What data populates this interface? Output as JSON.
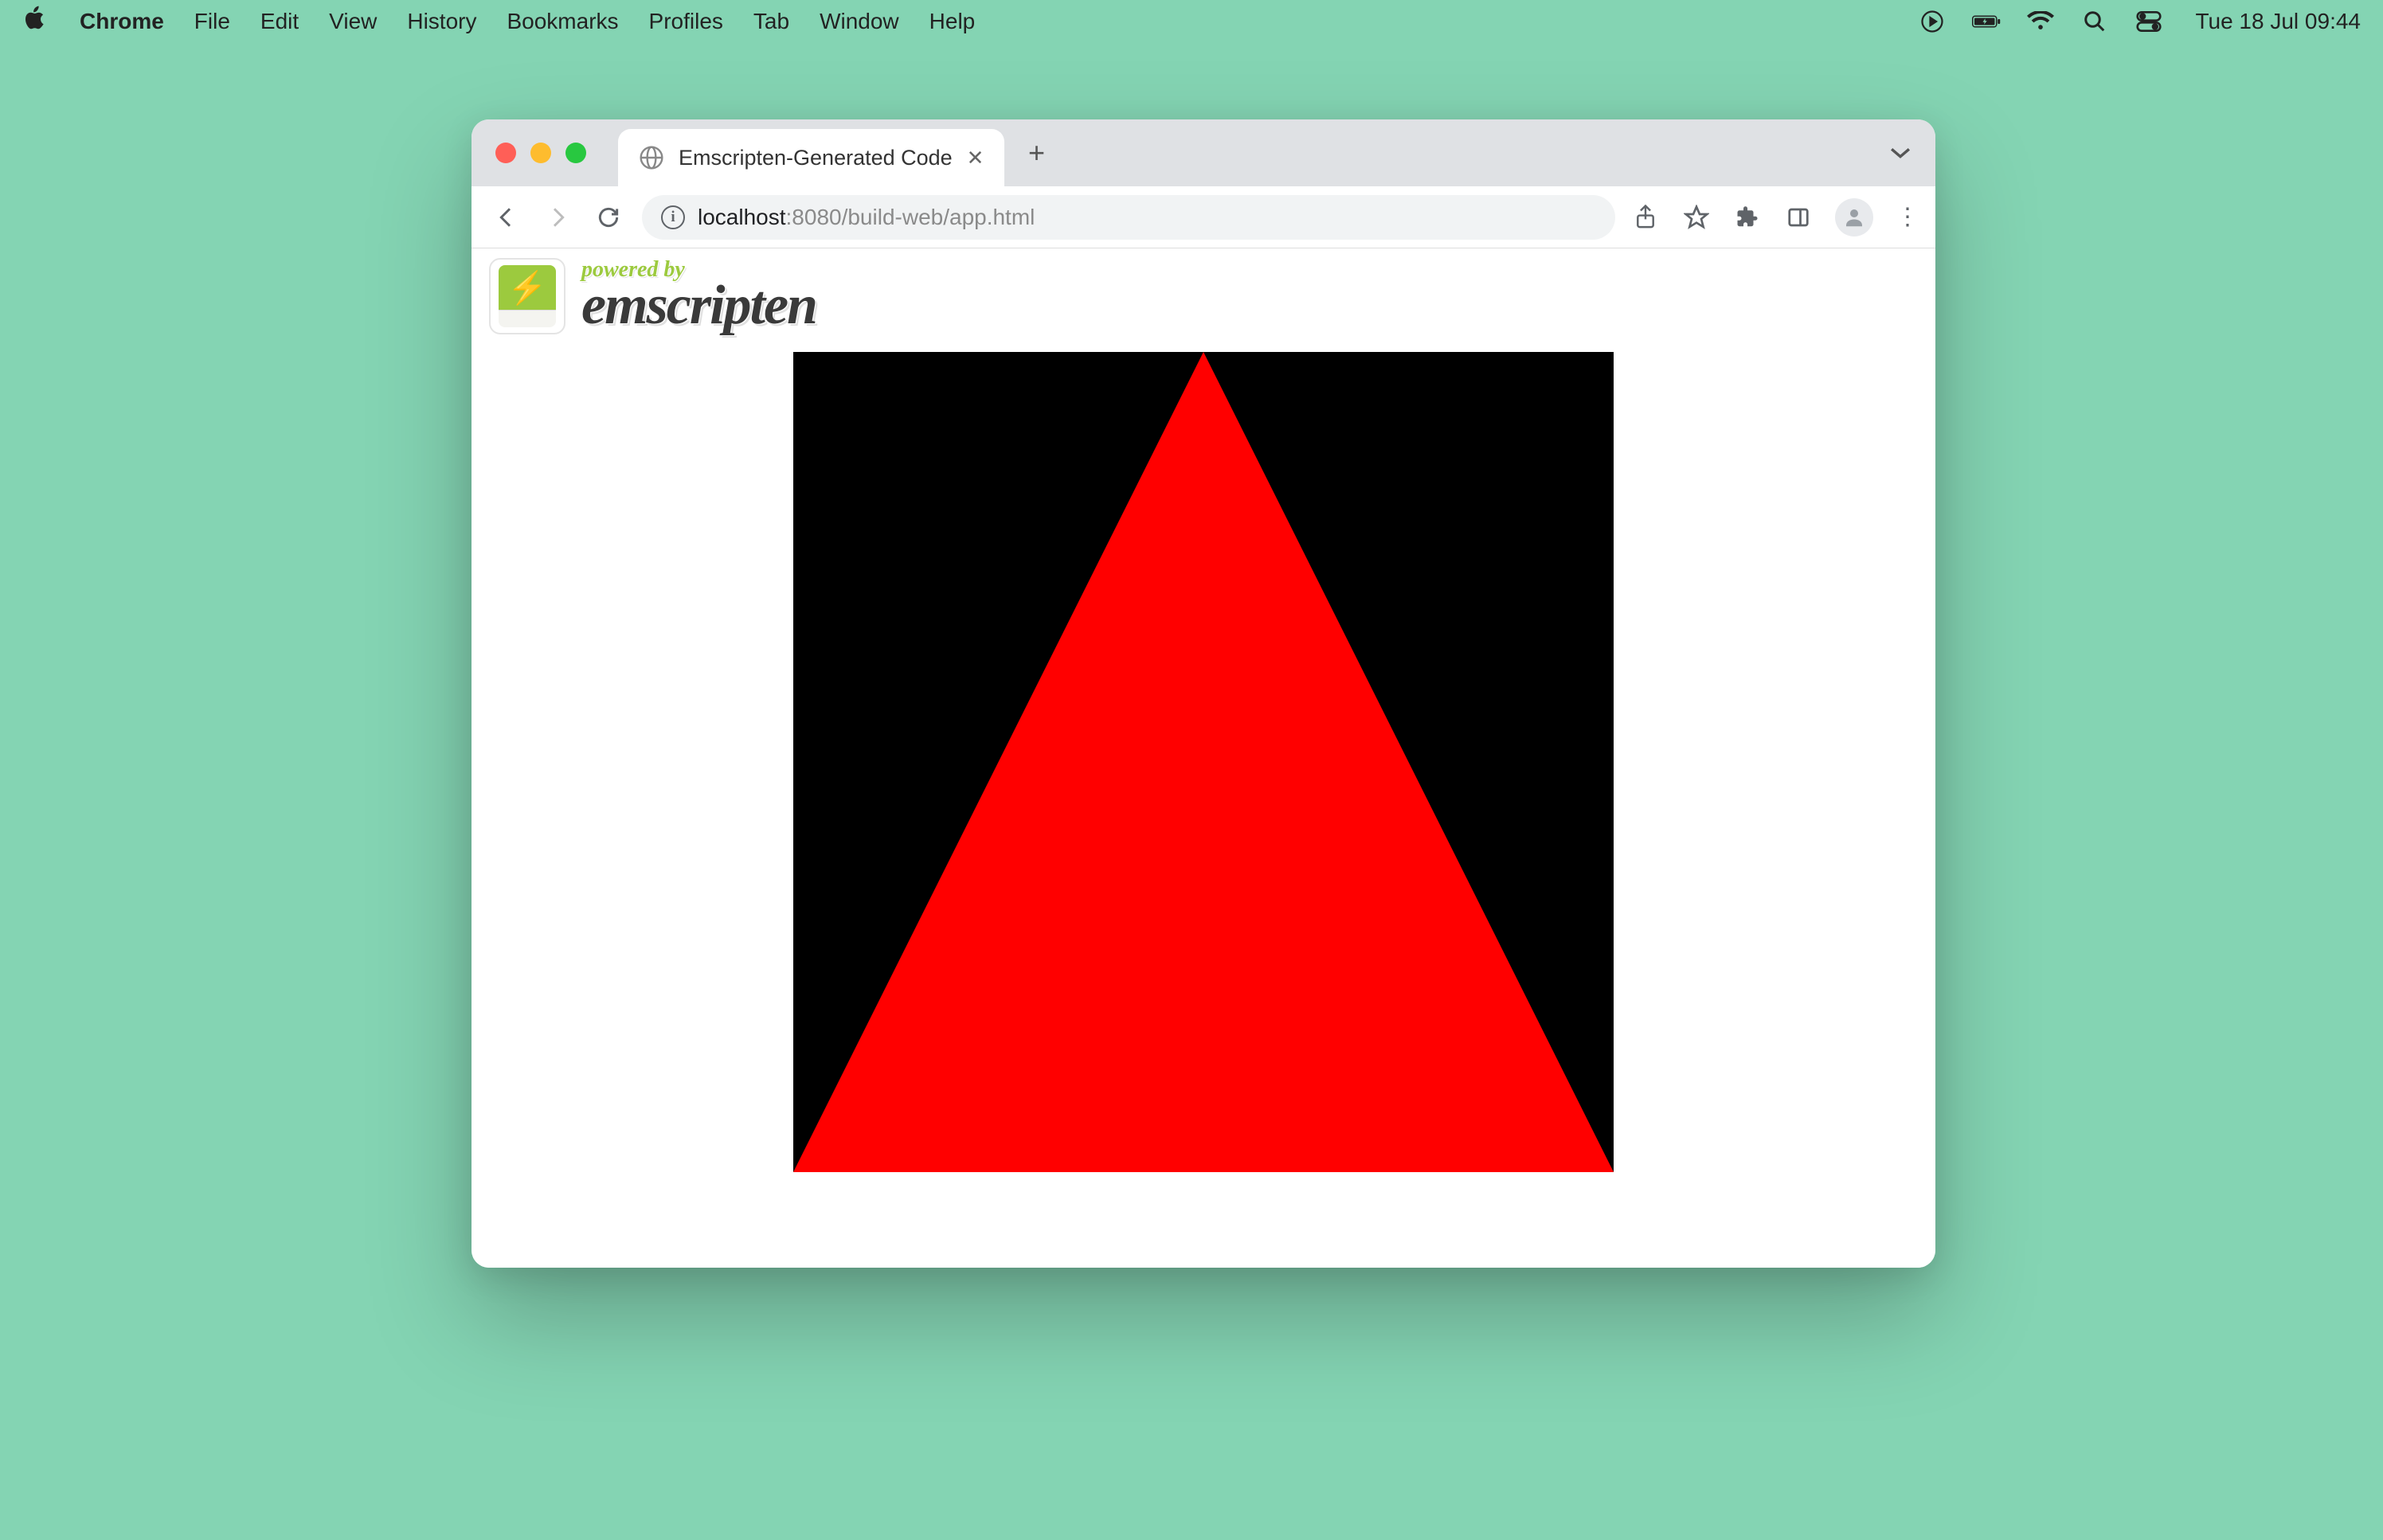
{
  "menubar": {
    "apple_icon": "apple-logo",
    "app_name": "Chrome",
    "items": [
      "File",
      "Edit",
      "View",
      "History",
      "Bookmarks",
      "Profiles",
      "Tab",
      "Window",
      "Help"
    ],
    "status_icons": [
      "screen-record-icon",
      "battery-charging-icon",
      "wifi-icon",
      "search-icon",
      "control-center-icon"
    ],
    "datetime": "Tue 18 Jul  09:44"
  },
  "browser": {
    "tab": {
      "title": "Emscripten-Generated Code",
      "favicon": "globe-icon"
    },
    "address": {
      "host": "localhost",
      "path": ":8080/build-web/app.html",
      "security_icon": "info-icon"
    },
    "toolbar_icons": {
      "share": "share-icon",
      "bookmark": "star-icon",
      "extensions": "puzzle-icon",
      "sidepanel": "panel-icon",
      "profile": "person-icon",
      "menu": "kebab-menu-icon"
    }
  },
  "page": {
    "logo_poweredby": "powered by",
    "logo_name": "emscripten",
    "canvas": {
      "background": "#000000",
      "triangle_color": "#ff0000",
      "triangle_vertices": [
        [
          0.5,
          0.0
        ],
        [
          0.0,
          1.0
        ],
        [
          1.0,
          1.0
        ]
      ]
    }
  }
}
